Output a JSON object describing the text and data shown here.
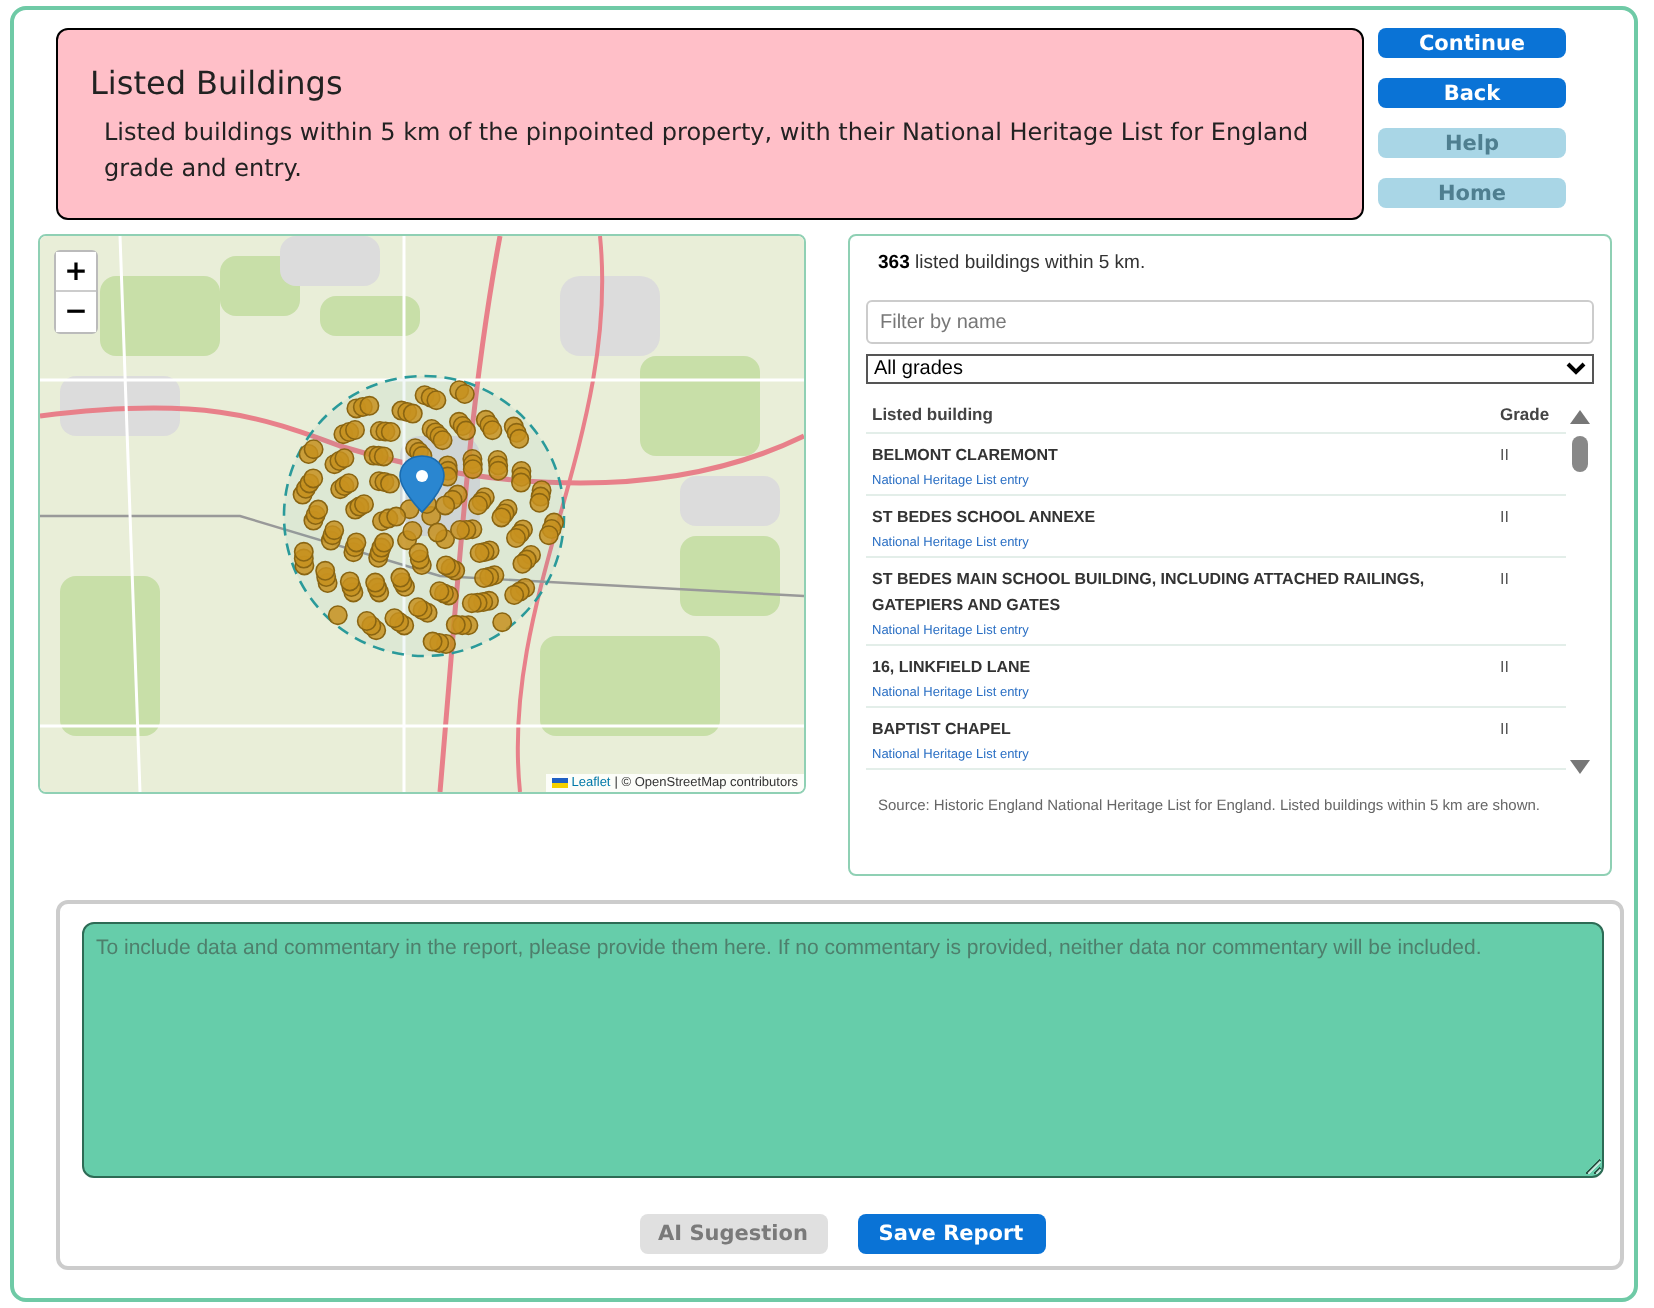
{
  "header": {
    "title": "Listed Buildings",
    "description": "Listed buildings within 5 km of the pinpointed property, with their National Heritage List for England grade and entry."
  },
  "nav_buttons": [
    {
      "label": "Continue",
      "disabled": false
    },
    {
      "label": "Back",
      "disabled": false
    },
    {
      "label": "Help",
      "disabled": true
    },
    {
      "label": "Home",
      "disabled": true
    }
  ],
  "map": {
    "zoom_controls": [
      "+",
      "−"
    ],
    "attribution_link": "Leaflet",
    "attribution": "| © OpenStreetMap contributors"
  },
  "listing": {
    "summary": "**363** listed buildings within 5 km.",
    "filter": {
      "placeholder": "Filter by name"
    },
    "grade_select": "All grades",
    "columns": [
      "Listed building",
      "Grade"
    ],
    "rows": [
      {
        "name": "BELMONT CLAREMONT",
        "link": "National Heritage List entry",
        "grade": "II"
      },
      {
        "name": "ST BEDES SCHOOL ANNEXE",
        "link": "National Heritage List entry",
        "grade": "II"
      },
      {
        "name": "ST BEDES MAIN SCHOOL BUILDING, INCLUDING ATTACHED RAILINGS, GATEPIERS AND GATES",
        "link": "National Heritage List entry",
        "grade": "II"
      },
      {
        "name": "16, LINKFIELD LANE",
        "link": "National Heritage List entry",
        "grade": "II"
      },
      {
        "name": "BAPTIST CHAPEL",
        "link": "National Heritage List entry",
        "grade": "II"
      }
    ],
    "source": "Source: Historic England National Heritage List for England. Listed buildings within 5 km are shown."
  },
  "commentary": {
    "placeholder": "To include data and commentary in the report, please provide them here. If no commentary is provided, neither data nor commentary will be included."
  },
  "actions": [
    {
      "label": "AI Sugestion",
      "disabled": true
    },
    {
      "label": "Save Report",
      "disabled": false
    }
  ]
}
